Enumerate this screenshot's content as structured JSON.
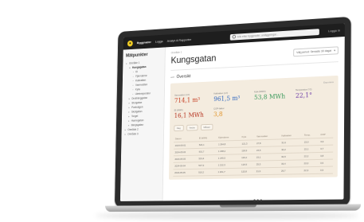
{
  "app": {
    "nav": [
      "Byggnader",
      "Logga",
      "Analys & Rapporter"
    ],
    "search_placeholder": "Sök efter byggnader, anläggningar...",
    "user_label": "Logga in"
  },
  "sidebar": {
    "title": "Mätpunkter",
    "items": [
      {
        "label": "Område 1",
        "level": 1,
        "active": false
      },
      {
        "label": "Kungsgatan",
        "level": 2,
        "active": true
      },
      {
        "label": "El",
        "level": 3,
        "active": false
      },
      {
        "label": "Fjärrvärme",
        "level": 3,
        "active": false
      },
      {
        "label": "Kallvatten",
        "level": 3,
        "active": false
      },
      {
        "label": "Varmvatten",
        "level": 3,
        "active": false
      },
      {
        "label": "Kyla",
        "level": 3,
        "active": false
      },
      {
        "label": "Utetemperatur",
        "level": 3,
        "active": false
      },
      {
        "label": "Drottninggatan",
        "level": 2,
        "active": false
      },
      {
        "label": "Storgatan",
        "level": 2,
        "active": false
      },
      {
        "label": "Parkvägen",
        "level": 2,
        "active": false
      },
      {
        "label": "Skolgatan",
        "level": 2,
        "active": false
      },
      {
        "label": "Torget",
        "level": 2,
        "active": false
      },
      {
        "label": "Hamngatan",
        "level": 2,
        "active": false
      },
      {
        "label": "Bergsgatan",
        "level": 2,
        "active": false
      },
      {
        "label": "Område 2",
        "level": 1,
        "active": false
      },
      {
        "label": "Område 3",
        "level": 1,
        "active": false
      }
    ]
  },
  "page": {
    "breadcrumb": "Område 1",
    "title": "Kungsgatan",
    "select_label": "Välj period: Senaste 30 dagar"
  },
  "overview": {
    "title": "Översikt",
    "panel_link": "Exportera",
    "kpis": [
      {
        "label": "Varmvatten (m³)",
        "value": "714,1 m³",
        "color": "red"
      },
      {
        "label": "Kallvatten (m³)",
        "value": "961,5 m³",
        "color": "blue"
      },
      {
        "label": "Kyla (MWh)",
        "value": "53,8 MWh",
        "color": "green"
      },
      {
        "label": "Temperatur (°C)",
        "value": "22,1°",
        "color": "purple"
      },
      {
        "label": "El (MWh)",
        "value": "16,1 MWh",
        "color": "darkred"
      },
      {
        "label": "COP-faktor",
        "value": "3,8",
        "color": "orange"
      }
    ]
  },
  "table": {
    "tools": [
      "Dag",
      "Vecka",
      "Månad"
    ],
    "headers": [
      "Datum",
      "El (kWh)",
      "Fjärrvärme",
      "Kyla",
      "Varmvatten",
      "Kallvatten",
      "Temp.",
      "COP"
    ],
    "rows": [
      [
        "2024-05-01",
        "524,1",
        "1 264,8",
        "121,3",
        "27,8",
        "31,6",
        "22,0",
        "3,9"
      ],
      [
        "2024-05-02",
        "531,7",
        "1 238,2",
        "118,9",
        "24,6",
        "30,2",
        "22,1",
        "3,7"
      ],
      [
        "2024-05-03",
        "519,4",
        "1 245,5",
        "116,2",
        "23,1",
        "32,9",
        "22,2",
        "3,8"
      ],
      [
        "2024-05-04",
        "547,9",
        "1 212,3",
        "124,5",
        "25,5",
        "33,4",
        "22,0",
        "3,6"
      ],
      [
        "2024-05-05",
        "510,2",
        "1 201,7",
        "115,8",
        "21,9",
        "29,7",
        "22,3",
        "3,9"
      ]
    ]
  },
  "colors": {
    "topbar": "#1e1e1e",
    "logo": "#f2cd24",
    "panel": "#f4ecdf",
    "red": "#c43a1e",
    "blue": "#2f66bf",
    "green": "#3a9a5b",
    "purple": "#6b3aa6",
    "orange": "#e09226",
    "darkred": "#b5321e"
  }
}
